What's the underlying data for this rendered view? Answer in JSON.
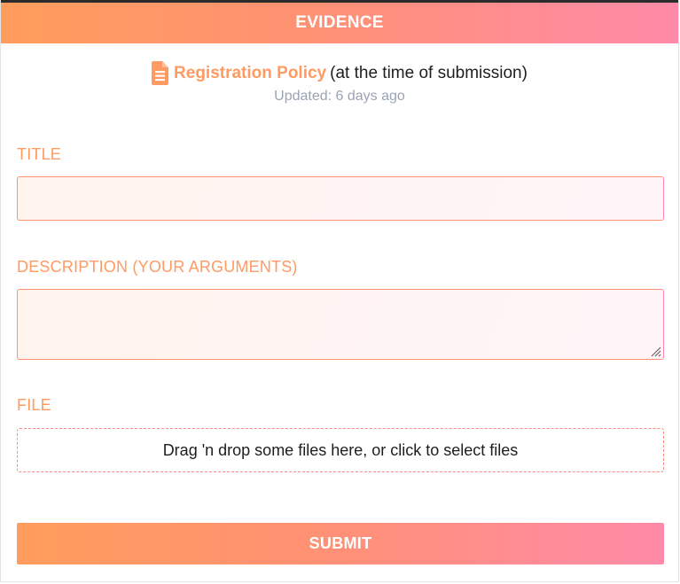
{
  "header": {
    "title": "EVIDENCE"
  },
  "policy": {
    "link_label": "Registration Policy",
    "suffix": "(at the time of submission)",
    "updated": "Updated: 6 days ago",
    "icon": "document-icon"
  },
  "form": {
    "title_label": "TITLE",
    "title_value": "",
    "description_label": "DESCRIPTION (YOUR ARGUMENTS)",
    "description_value": "",
    "file_label": "FILE",
    "dropzone_text": "Drag 'n drop some files here, or click to select files",
    "submit_label": "SUBMIT"
  },
  "colors": {
    "accent_orange": "#ff9a62",
    "accent_pink": "#ff8aa8",
    "muted_text": "#9aa3b5"
  }
}
